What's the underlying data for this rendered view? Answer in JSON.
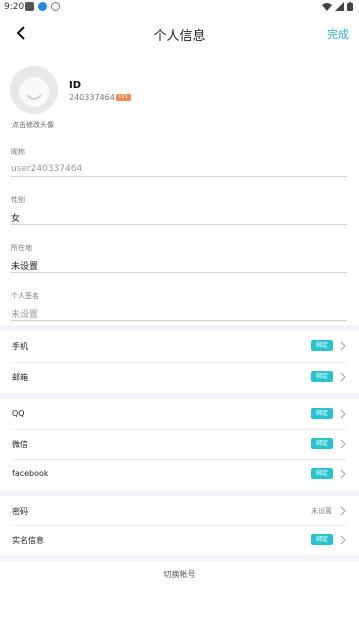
{
  "status_bar": {
    "time": "9:20"
  },
  "header": {
    "title": "个人信息",
    "done_label": "完成"
  },
  "profile": {
    "avatar_caption": "点击修改头像",
    "id_label": "ID",
    "id_value": "240337464",
    "level_badge": "LV1"
  },
  "fields": [
    {
      "label": "昵称",
      "value": "user240337464"
    },
    {
      "label": "性别",
      "value": "女"
    },
    {
      "label": "所在地",
      "value": "未设置"
    },
    {
      "label": "个人签名",
      "value": "未设置"
    }
  ],
  "groups": {
    "contact": [
      {
        "label": "手机",
        "badge": "绑定"
      },
      {
        "label": "邮箱",
        "badge": "绑定"
      }
    ],
    "social": [
      {
        "label": "QQ",
        "badge": "绑定"
      },
      {
        "label": "微信",
        "badge": "绑定"
      },
      {
        "label": "facebook",
        "badge": "绑定"
      }
    ],
    "security": [
      {
        "label": "密码",
        "status": "未设置"
      },
      {
        "label": "实名信息",
        "badge": "绑定"
      }
    ]
  },
  "switch_account_label": "切换帐号",
  "colors": {
    "accent": "#27b4c8",
    "badge": "#27c4cf",
    "level": "#f08a4b"
  }
}
